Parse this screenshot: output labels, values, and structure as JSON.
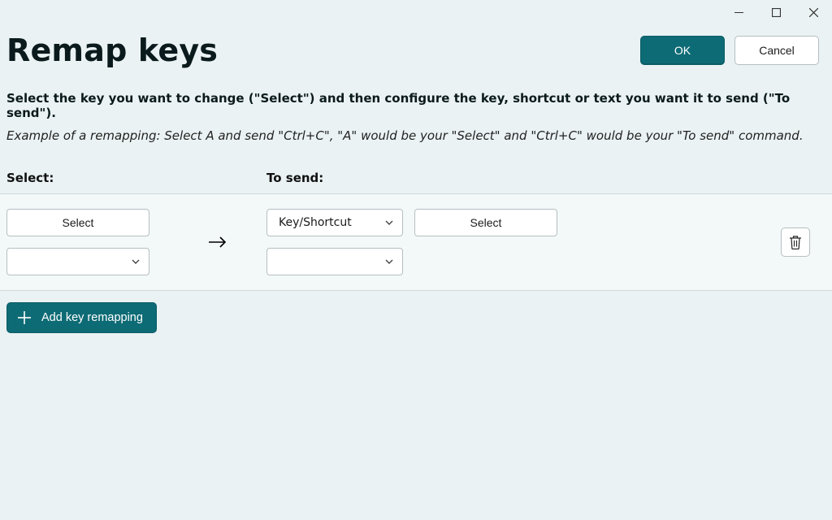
{
  "window": {
    "title": "Remap keys",
    "minimize_aria": "Minimize",
    "maximize_aria": "Maximize",
    "close_aria": "Close"
  },
  "header": {
    "page_title": "Remap keys",
    "ok_label": "OK",
    "cancel_label": "Cancel"
  },
  "intro": {
    "instruction": "Select the key you want to change (\"Select\") and then configure the key, shortcut or text you want it to send (\"To send\").",
    "example": "Example of a remapping: Select A and send \"Ctrl+C\", \"A\" would be your \"Select\" and \"Ctrl+C\" would be your \"To send\" command."
  },
  "columns": {
    "select_label": "Select:",
    "to_send_label": "To send:"
  },
  "row": {
    "select_button_label": "Select",
    "select_dropdown_value": "",
    "mode_dropdown_value": "Key/Shortcut",
    "to_send_button_label": "Select",
    "to_send_dropdown_value": "",
    "delete_aria": "Delete remapping"
  },
  "footer": {
    "add_label": "Add key remapping"
  },
  "colors": {
    "accent": "#0d6b75",
    "background": "#eaf2f3"
  }
}
